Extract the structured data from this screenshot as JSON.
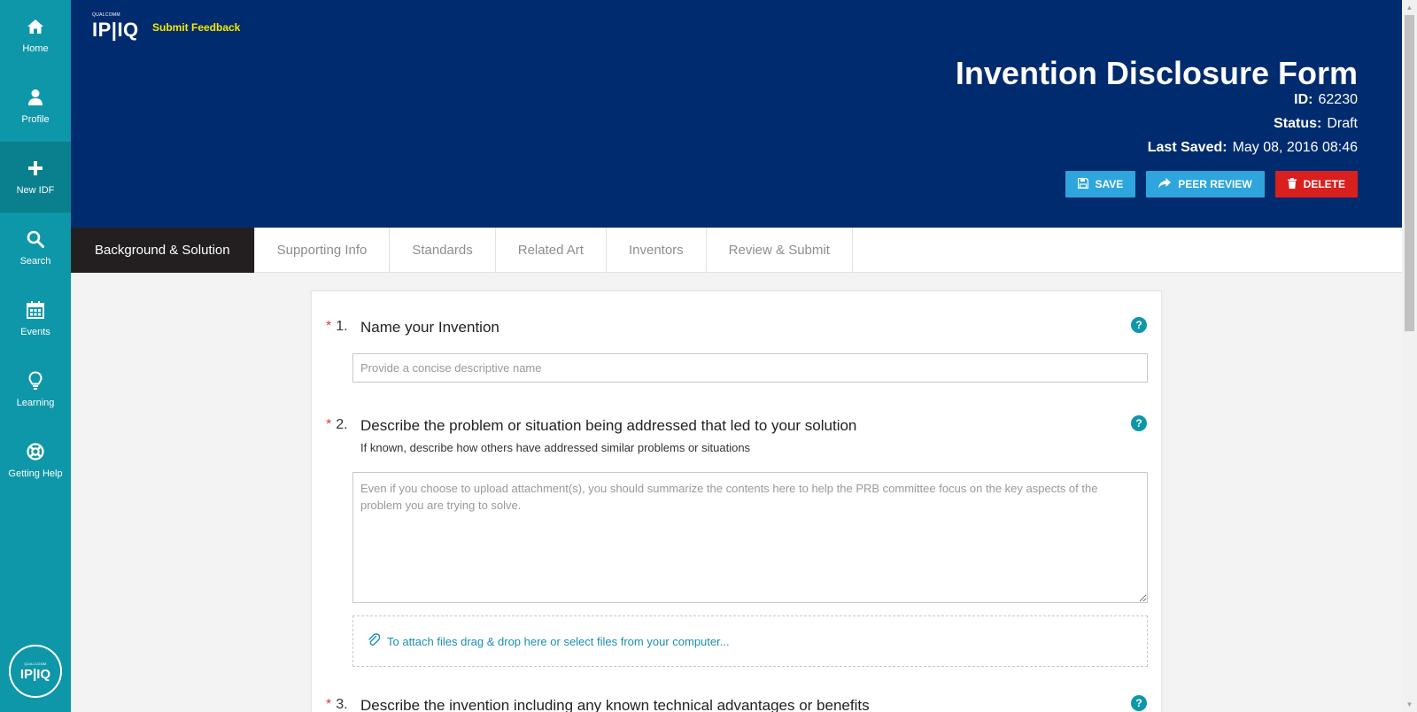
{
  "sidebar": {
    "items": [
      {
        "label": "Home",
        "icon": "home-icon"
      },
      {
        "label": "Profile",
        "icon": "user-icon"
      },
      {
        "label": "New IDF",
        "icon": "plus-icon",
        "active": true
      },
      {
        "label": "Search",
        "icon": "search-icon"
      },
      {
        "label": "Events",
        "icon": "calendar-icon"
      },
      {
        "label": "Learning",
        "icon": "lightbulb-icon"
      },
      {
        "label": "Getting Help",
        "icon": "lifebuoy-icon"
      }
    ],
    "logo": {
      "small": "QUALCOMM",
      "big": "IP|IQ"
    }
  },
  "header": {
    "logo": {
      "small": "QUALCOMM",
      "big": "IP|IQ"
    },
    "feedback_link": "Submit Feedback",
    "title": "Invention Disclosure Form",
    "id_label": "ID:",
    "id_value": "62230",
    "status_label": "Status:",
    "status_value": "Draft",
    "last_saved_label": "Last Saved:",
    "last_saved_value": "May 08, 2016 08:46",
    "buttons": {
      "save": "SAVE",
      "peer_review": "PEER REVIEW",
      "delete": "DELETE"
    }
  },
  "tabs": [
    {
      "label": "Background & Solution",
      "active": true
    },
    {
      "label": "Supporting Info"
    },
    {
      "label": "Standards"
    },
    {
      "label": "Related Art"
    },
    {
      "label": "Inventors"
    },
    {
      "label": "Review & Submit"
    }
  ],
  "form": {
    "questions": [
      {
        "number": "1.",
        "title": "Name your Invention",
        "placeholder": "Provide a concise descriptive name"
      },
      {
        "number": "2.",
        "title": "Describe the problem or situation being addressed that led to your solution",
        "subtitle": "If known, describe how others have addressed similar problems or situations",
        "placeholder": "Even if you choose to upload attachment(s), you should summarize the contents here to help the PRB committee focus on the key aspects of the problem you are trying to solve.",
        "attach_text": "To attach files drag & drop here or select files from your computer..."
      },
      {
        "number": "3.",
        "title": "Describe the invention including any known technical advantages or benefits"
      }
    ],
    "required_mark": "*",
    "help_glyph": "?"
  },
  "colors": {
    "sidebar": "#0e97a9",
    "sidebar_active": "#0a7f8e",
    "header": "#002b6e",
    "feedback_link": "#f5e900",
    "button_blue": "#2ea6dd",
    "button_red": "#d9201f",
    "active_tab": "#231f20"
  }
}
